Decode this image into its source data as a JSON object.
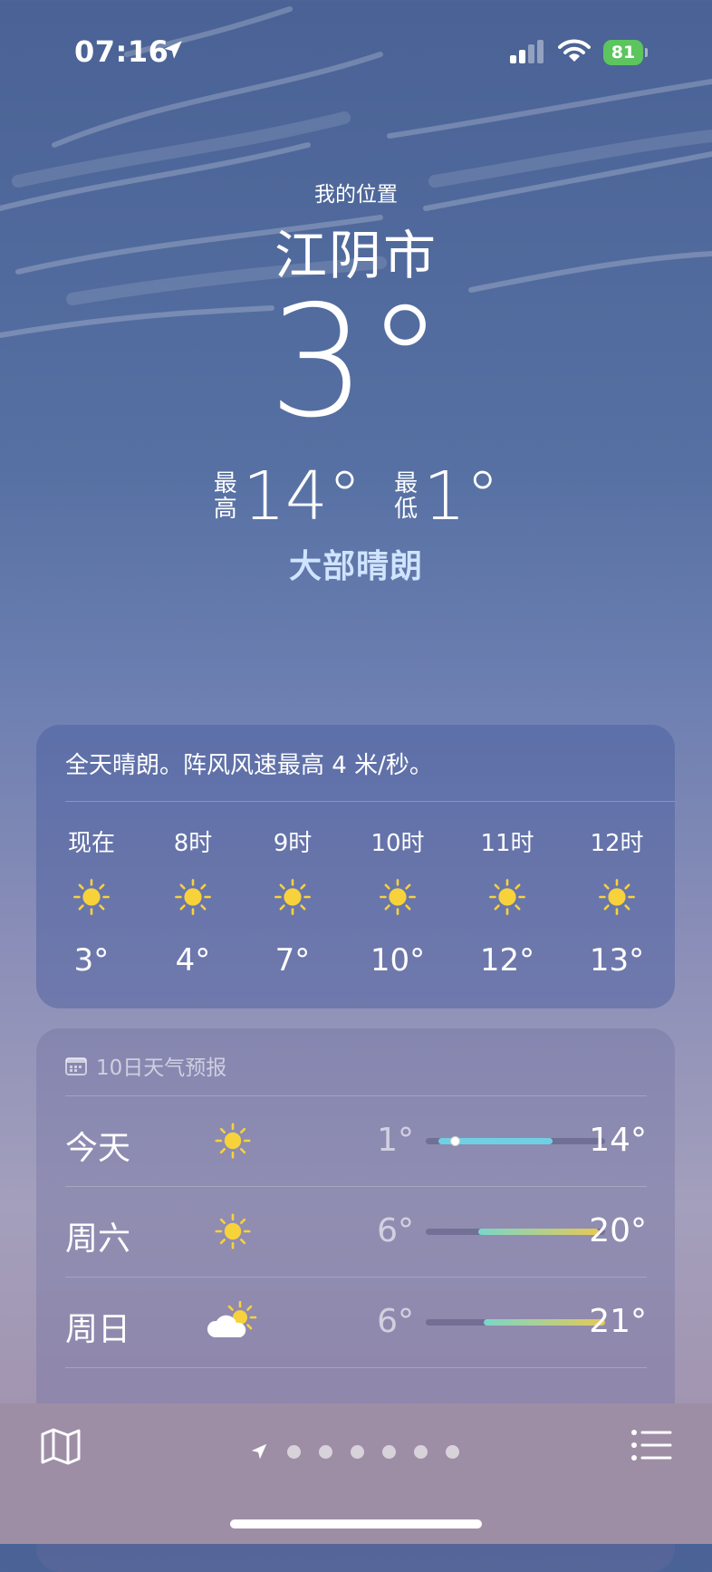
{
  "status": {
    "time": "07:16",
    "battery": "81"
  },
  "header": {
    "location_label": "我的位置",
    "city": "江阴市",
    "temp": "3°",
    "high_label": "最高",
    "high": "14°",
    "low_label": "最低",
    "low": "1°",
    "condition": "大部晴朗"
  },
  "hourly": {
    "summary": "全天晴朗。阵风风速最高 4 米/秒。",
    "items": [
      {
        "hour": "现在",
        "icon": "sun-icon",
        "temp": "3°"
      },
      {
        "hour": "8时",
        "icon": "sun-icon",
        "temp": "4°"
      },
      {
        "hour": "9时",
        "icon": "sun-icon",
        "temp": "7°"
      },
      {
        "hour": "10时",
        "icon": "sun-icon",
        "temp": "10°"
      },
      {
        "hour": "11时",
        "icon": "sun-icon",
        "temp": "12°"
      },
      {
        "hour": "12时",
        "icon": "sun-icon",
        "temp": "13°"
      }
    ]
  },
  "daily": {
    "title": "10日天气预报",
    "rows": [
      {
        "day": "今天",
        "icon": "sun-icon",
        "low": "1°",
        "high": "14°"
      },
      {
        "day": "周六",
        "icon": "sun-icon",
        "low": "6°",
        "high": "20°"
      },
      {
        "day": "周日",
        "icon": "partly-cloudy-icon",
        "low": "6°",
        "high": "21°"
      }
    ]
  },
  "colors": {
    "sun": "#f7d23b",
    "bar_cool": "#6fd0e3",
    "bar_warm": "#e6c955",
    "battery": "#5cc55e"
  }
}
